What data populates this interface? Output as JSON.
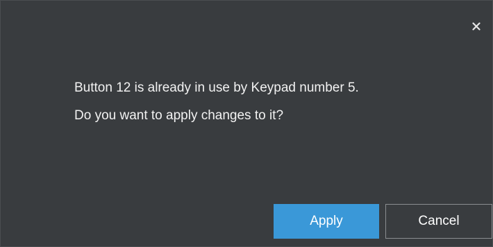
{
  "dialog": {
    "close_icon": "close-icon",
    "message_line_1": "Button 12 is already in use by Keypad number 5.",
    "message_line_2": "Do you want to apply changes to it?",
    "apply_label": "Apply",
    "cancel_label": "Cancel"
  },
  "colors": {
    "background": "#393c3f",
    "primary_button": "#3a98d8",
    "text": "#ffffff",
    "cancel_border": "#8b8e91"
  }
}
